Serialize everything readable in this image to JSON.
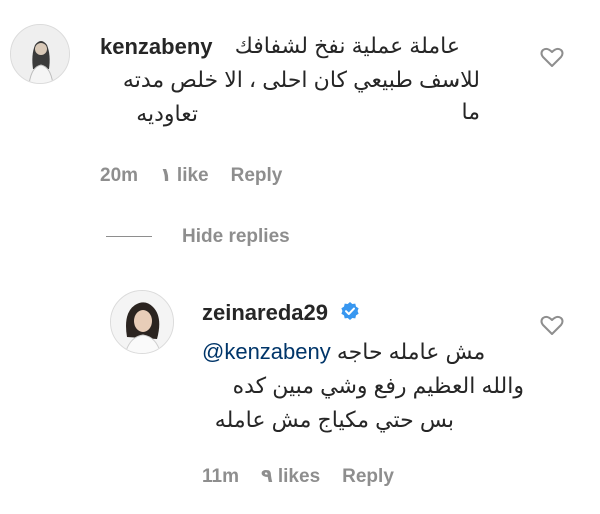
{
  "comments": [
    {
      "username": "kenzabeny",
      "text_lines": [
        "عاملة عملية نفخ لشفافك ،",
        "للاسف طبيعي كان احلى ، الا خلص مدته ما",
        "تعاوديه"
      ],
      "time": "20m",
      "likes": "١ like",
      "reply_label": "Reply",
      "like_icon": "heart-outline-icon"
    },
    {
      "username": "zeinareda29",
      "verified": true,
      "mention": "@kenzabeny",
      "text_lines": [
        "مش عامله حاجه",
        "والله العظيم رفع وشي مبين كده",
        "بس حتي مكياج مش عامله"
      ],
      "time": "11m",
      "likes": "٩ likes",
      "reply_label": "Reply",
      "like_icon": "heart-outline-icon"
    }
  ],
  "hide_replies_label": "Hide replies",
  "colors": {
    "username": "#262626",
    "meta": "#8e8e8e",
    "mention": "#003569",
    "verified": "#3897f0"
  }
}
